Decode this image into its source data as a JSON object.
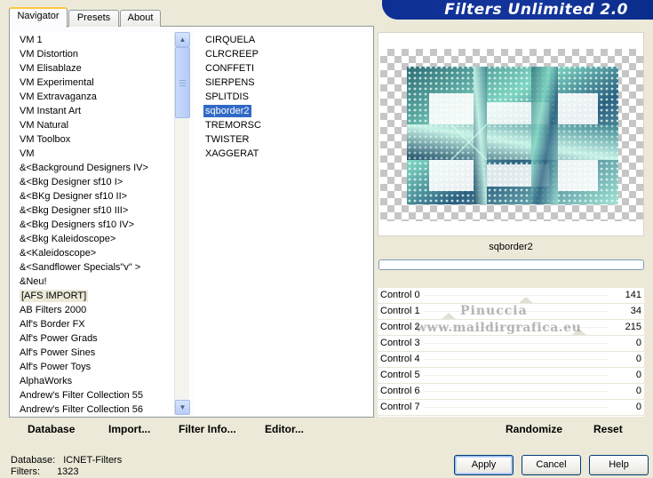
{
  "window_title": "Filters Unlimited 2.0",
  "tabs": [
    {
      "label": "Navigator",
      "active": true
    },
    {
      "label": "Presets",
      "active": false
    },
    {
      "label": "About",
      "active": false
    }
  ],
  "categories": [
    "VM 1",
    "VM Distortion",
    "VM Elisablaze",
    "VM Experimental",
    "VM Extravaganza",
    "VM Instant Art",
    "VM Natural",
    "VM Toolbox",
    "VM",
    "&<Background Designers IV>",
    "&<Bkg Designer sf10 I>",
    "&<BKg Designer sf10 II>",
    "&<Bkg Designer sf10 III>",
    "&<Bkg Designers sf10 IV>",
    "&<Bkg Kaleidoscope>",
    "&<Kaleidoscope>",
    "&<Sandflower Specials\"v\" >",
    "&Neu!",
    "[AFS IMPORT]",
    "AB Filters 2000",
    "Alf's Border FX",
    "Alf's Power Grads",
    "Alf's Power Sines",
    "Alf's Power Toys",
    "AlphaWorks",
    "Andrew's Filter Collection 55",
    "Andrew's Filter Collection 56"
  ],
  "selected_category": "[AFS IMPORT]",
  "filters": [
    "CIRQUELA",
    "CLRCREEP",
    "CONFFETI",
    "SIERPENS",
    "SPLITDIS",
    "sqborder2",
    "TREMORSC",
    "TWISTER",
    "XAGGERAT"
  ],
  "selected_filter": "sqborder2",
  "preview_label": "sqborder2",
  "controls": [
    {
      "label": "Control 0",
      "value": "141",
      "slider": 141
    },
    {
      "label": "Control 1",
      "value": "34",
      "slider": 34
    },
    {
      "label": "Control 2",
      "value": "215",
      "slider": 215
    },
    {
      "label": "Control 3",
      "value": "0",
      "slider": 0
    },
    {
      "label": "Control 4",
      "value": "0",
      "slider": 0
    },
    {
      "label": "Control 5",
      "value": "0",
      "slider": 0
    },
    {
      "label": "Control 6",
      "value": "0",
      "slider": 0
    },
    {
      "label": "Control 7",
      "value": "0",
      "slider": 0
    }
  ],
  "watermark": {
    "line1": "Pinuccia",
    "line2": "www.maildirgrafica.eu"
  },
  "toolbar": {
    "database": "Database",
    "import": "Import...",
    "filter_info": "Filter Info...",
    "editor": "Editor...",
    "randomize": "Randomize",
    "reset": "Reset"
  },
  "status": {
    "database_label": "Database:",
    "database_value": "ICNET-Filters",
    "filters_label": "Filters:",
    "filters_value": "1323"
  },
  "buttons": {
    "apply": "Apply",
    "cancel": "Cancel",
    "help": "Help"
  },
  "colors": {
    "selection": "#316ac5",
    "banner": "#0a2c8a",
    "dialog_bg": "#ece9d8"
  }
}
